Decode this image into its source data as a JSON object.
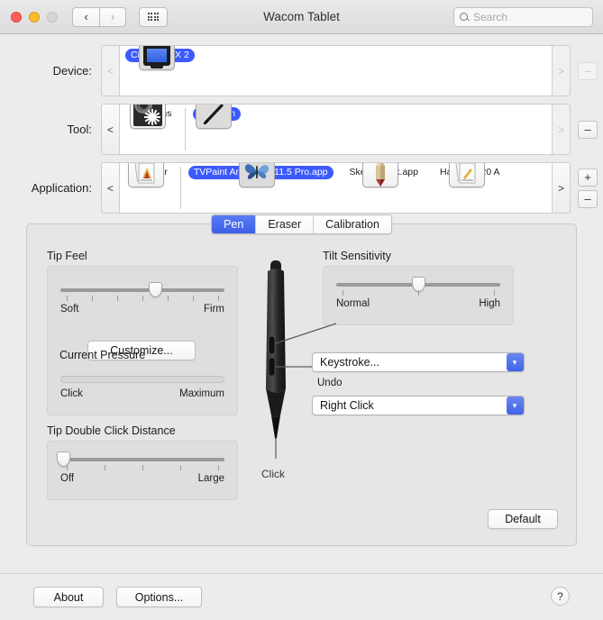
{
  "window": {
    "title": "Wacom Tablet",
    "traffic_lights": [
      "close",
      "minimize",
      "zoom-disabled"
    ],
    "nav_back": "‹",
    "nav_forward": "›",
    "grid_button": "show-all-icon"
  },
  "search": {
    "placeholder": "Search",
    "icon": "search-icon"
  },
  "rows": [
    {
      "label": "Device:",
      "left_arrow": "<",
      "right_arrow": ">",
      "left_enabled": false,
      "right_enabled": false,
      "items": [
        {
          "caption": "Cintiq 21UX 2",
          "icon": "display-monitor-icon",
          "selected": true
        }
      ],
      "side_buttons": [
        {
          "label": "–",
          "name": "remove-device-button",
          "enabled": false
        }
      ]
    },
    {
      "label": "Tool:",
      "left_arrow": "<",
      "right_arrow": ">",
      "left_enabled": true,
      "right_enabled": false,
      "items": [
        {
          "caption": "Functions",
          "icon": "tablet-functions-icon",
          "selected": false
        },
        {
          "caption": "Grip Pen",
          "icon": "grip-pen-icon",
          "selected": true
        }
      ],
      "side_buttons": [
        {
          "label": "–",
          "name": "remove-tool-button",
          "enabled": true
        }
      ]
    },
    {
      "label": "Application:",
      "left_arrow": "<",
      "right_arrow": ">",
      "left_enabled": true,
      "right_enabled": true,
      "items": [
        {
          "caption": "All Other",
          "icon": "all-other-apps-icon",
          "selected": false
        },
        {
          "caption": "TVPaint Animation 11.5 Pro.app",
          "icon": "butterfly-icon",
          "selected": true
        },
        {
          "caption": "SketchBook.app",
          "icon": "pencil-icon",
          "selected": false
        },
        {
          "caption": "Harmony 20 A",
          "icon": "document-icon",
          "selected": false
        }
      ],
      "side_buttons": [
        {
          "label": "+",
          "name": "add-application-button",
          "enabled": true
        },
        {
          "label": "–",
          "name": "remove-application-button",
          "enabled": true
        }
      ]
    }
  ],
  "tabs": [
    {
      "label": "Pen",
      "active": true
    },
    {
      "label": "Eraser",
      "active": false
    },
    {
      "label": "Calibration",
      "active": false
    }
  ],
  "tip_feel": {
    "title": "Tip Feel",
    "min_label": "Soft",
    "max_label": "Firm",
    "value_percent": 58,
    "tick_count": 7,
    "customize_button": "Customize...",
    "current_pressure_title": "Current Pressure",
    "pressure_min_label": "Click",
    "pressure_max_label": "Maximum",
    "pressure_percent": 0
  },
  "tip_double_click": {
    "title": "Tip Double Click Distance",
    "min_label": "Off",
    "max_label": "Large",
    "value_percent": 2,
    "tick_count": 5
  },
  "tilt": {
    "title": "Tilt Sensitivity",
    "min_label": "Normal",
    "max_label": "High",
    "value_percent": 50,
    "tick_count": 3
  },
  "pen": {
    "illustration": "stylus-pen-illustration",
    "tip_label": "Click",
    "upper_button": {
      "value": "Keystroke...",
      "sub_label": "Undo",
      "arrow": "▾"
    },
    "lower_button": {
      "value": "Right Click",
      "arrow": "▾"
    }
  },
  "default_button": "Default",
  "bottom_bar": {
    "about_button": "About",
    "options_button": "Options...",
    "help_button": "?"
  },
  "colors": {
    "accent_blue": "#3d5afe",
    "tab_active": "#4363e8",
    "window_bg": "#ececec",
    "panel_bg": "#e6e6e6",
    "group_bg": "#dedede"
  }
}
